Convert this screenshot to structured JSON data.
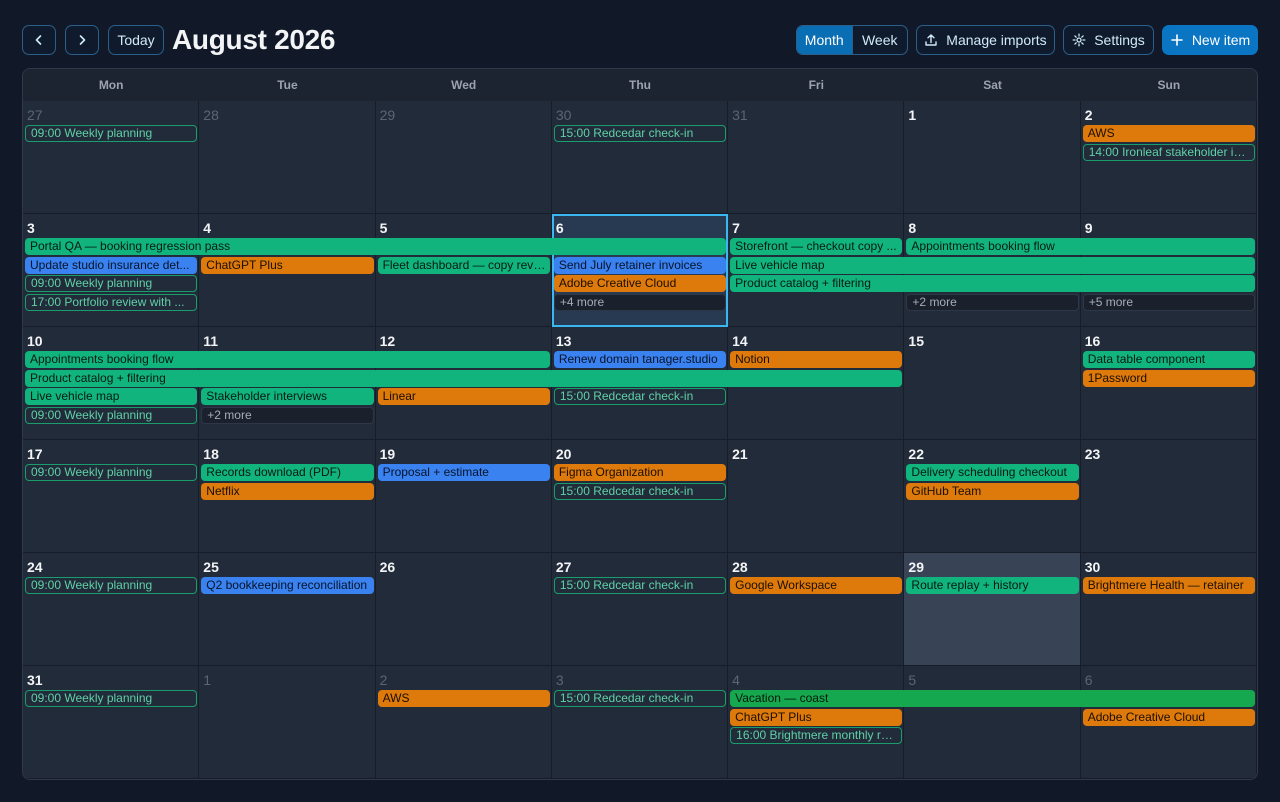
{
  "header": {
    "today_label": "Today",
    "title": "August 2026",
    "view_month": "Month",
    "view_week": "Week",
    "manage_imports": "Manage imports",
    "settings": "Settings",
    "new_item": "New item"
  },
  "colors": {
    "accent": "#0a75c2",
    "event_green": "#10b47c",
    "event_orange": "#dd7a0b",
    "event_blue": "#3a82f0",
    "today_border": "#3ab7f0"
  },
  "calendar": {
    "weekdays": [
      "Mon",
      "Tue",
      "Wed",
      "Thu",
      "Fri",
      "Sat",
      "Sun"
    ],
    "today": {
      "week": 1,
      "day": 3
    },
    "selected": {
      "week": 4,
      "day": 5
    },
    "weeks": [
      [
        {
          "num": "27",
          "other": true
        },
        {
          "num": "28",
          "other": true
        },
        {
          "num": "29",
          "other": true
        },
        {
          "num": "30",
          "other": true
        },
        {
          "num": "31",
          "other": true
        },
        {
          "num": "1"
        },
        {
          "num": "2"
        }
      ],
      [
        {
          "num": "3"
        },
        {
          "num": "4"
        },
        {
          "num": "5"
        },
        {
          "num": "6"
        },
        {
          "num": "7"
        },
        {
          "num": "8"
        },
        {
          "num": "9"
        }
      ],
      [
        {
          "num": "10"
        },
        {
          "num": "11"
        },
        {
          "num": "12"
        },
        {
          "num": "13"
        },
        {
          "num": "14"
        },
        {
          "num": "15"
        },
        {
          "num": "16"
        }
      ],
      [
        {
          "num": "17"
        },
        {
          "num": "18"
        },
        {
          "num": "19"
        },
        {
          "num": "20"
        },
        {
          "num": "21"
        },
        {
          "num": "22"
        },
        {
          "num": "23"
        }
      ],
      [
        {
          "num": "24"
        },
        {
          "num": "25"
        },
        {
          "num": "26"
        },
        {
          "num": "27"
        },
        {
          "num": "28"
        },
        {
          "num": "29"
        },
        {
          "num": "30"
        }
      ],
      [
        {
          "num": "31"
        },
        {
          "num": "1",
          "other": true
        },
        {
          "num": "2",
          "other": true
        },
        {
          "num": "3",
          "other": true
        },
        {
          "num": "4",
          "other": true
        },
        {
          "num": "5",
          "other": true
        },
        {
          "num": "6",
          "other": true
        }
      ]
    ],
    "events": [
      {
        "week": 0,
        "day": 0,
        "span": 1,
        "lane": 0,
        "style": "outline",
        "text": "09:00 Weekly planning"
      },
      {
        "week": 0,
        "day": 3,
        "span": 1,
        "lane": 0,
        "style": "outline",
        "text": "15:00 Redcedar check-in"
      },
      {
        "week": 0,
        "day": 6,
        "span": 1,
        "lane": 0,
        "style": "orange",
        "text": "AWS"
      },
      {
        "week": 0,
        "day": 6,
        "span": 1,
        "lane": 1,
        "style": "outline",
        "text": "14:00 Ironleaf stakeholder in..."
      },
      {
        "week": 1,
        "day": 0,
        "span": 4,
        "lane": 0,
        "style": "green",
        "text": "Portal QA — booking regression pass"
      },
      {
        "week": 1,
        "day": 4,
        "span": 1,
        "lane": 0,
        "style": "green",
        "text": "Storefront — checkout copy ..."
      },
      {
        "week": 1,
        "day": 5,
        "span": 2,
        "lane": 0,
        "style": "green",
        "text": "Appointments booking flow"
      },
      {
        "week": 1,
        "day": 0,
        "span": 1,
        "lane": 1,
        "style": "blue",
        "text": "Update studio insurance det..."
      },
      {
        "week": 1,
        "day": 1,
        "span": 1,
        "lane": 1,
        "style": "orange",
        "text": "ChatGPT Plus"
      },
      {
        "week": 1,
        "day": 2,
        "span": 1,
        "lane": 1,
        "style": "green",
        "text": "Fleet dashboard — copy revi..."
      },
      {
        "week": 1,
        "day": 3,
        "span": 1,
        "lane": 1,
        "style": "blue",
        "text": "Send July retainer invoices"
      },
      {
        "week": 1,
        "day": 4,
        "span": 3,
        "lane": 1,
        "style": "green",
        "text": "Live vehicle map"
      },
      {
        "week": 1,
        "day": 0,
        "span": 1,
        "lane": 2,
        "style": "outline",
        "text": "09:00 Weekly planning"
      },
      {
        "week": 1,
        "day": 3,
        "span": 1,
        "lane": 2,
        "style": "orange",
        "text": "Adobe Creative Cloud"
      },
      {
        "week": 1,
        "day": 4,
        "span": 3,
        "lane": 2,
        "style": "green",
        "text": "Product catalog + filtering"
      },
      {
        "week": 1,
        "day": 0,
        "span": 1,
        "lane": 3,
        "style": "outline",
        "text": "17:00 Portfolio review with ..."
      },
      {
        "week": 1,
        "day": 3,
        "span": 1,
        "lane": 3,
        "style": "more",
        "text": "+4 more"
      },
      {
        "week": 1,
        "day": 5,
        "span": 1,
        "lane": 3,
        "style": "more",
        "text": "+2 more"
      },
      {
        "week": 1,
        "day": 6,
        "span": 1,
        "lane": 3,
        "style": "more",
        "text": "+5 more"
      },
      {
        "week": 2,
        "day": 0,
        "span": 3,
        "lane": 0,
        "style": "green",
        "text": "Appointments booking flow"
      },
      {
        "week": 2,
        "day": 3,
        "span": 1,
        "lane": 0,
        "style": "blue",
        "text": "Renew domain tanager.studio"
      },
      {
        "week": 2,
        "day": 4,
        "span": 1,
        "lane": 0,
        "style": "orange",
        "text": "Notion"
      },
      {
        "week": 2,
        "day": 6,
        "span": 1,
        "lane": 0,
        "style": "green",
        "text": "Data table component"
      },
      {
        "week": 2,
        "day": 0,
        "span": 5,
        "lane": 1,
        "style": "green",
        "text": "Product catalog + filtering"
      },
      {
        "week": 2,
        "day": 6,
        "span": 1,
        "lane": 1,
        "style": "orange",
        "text": "1Password"
      },
      {
        "week": 2,
        "day": 0,
        "span": 1,
        "lane": 2,
        "style": "green",
        "text": "Live vehicle map"
      },
      {
        "week": 2,
        "day": 1,
        "span": 1,
        "lane": 2,
        "style": "green",
        "text": "Stakeholder interviews"
      },
      {
        "week": 2,
        "day": 2,
        "span": 1,
        "lane": 2,
        "style": "orange",
        "text": "Linear"
      },
      {
        "week": 2,
        "day": 3,
        "span": 1,
        "lane": 2,
        "style": "outline",
        "text": "15:00 Redcedar check-in"
      },
      {
        "week": 2,
        "day": 0,
        "span": 1,
        "lane": 3,
        "style": "outline",
        "text": "09:00 Weekly planning"
      },
      {
        "week": 2,
        "day": 1,
        "span": 1,
        "lane": 3,
        "style": "more",
        "text": "+2 more"
      },
      {
        "week": 3,
        "day": 0,
        "span": 1,
        "lane": 0,
        "style": "outline",
        "text": "09:00 Weekly planning"
      },
      {
        "week": 3,
        "day": 1,
        "span": 1,
        "lane": 0,
        "style": "green",
        "text": "Records download (PDF)"
      },
      {
        "week": 3,
        "day": 2,
        "span": 1,
        "lane": 0,
        "style": "blue",
        "text": "Proposal + estimate"
      },
      {
        "week": 3,
        "day": 3,
        "span": 1,
        "lane": 0,
        "style": "orange",
        "text": "Figma Organization"
      },
      {
        "week": 3,
        "day": 5,
        "span": 1,
        "lane": 0,
        "style": "green",
        "text": "Delivery scheduling checkout"
      },
      {
        "week": 3,
        "day": 1,
        "span": 1,
        "lane": 1,
        "style": "orange",
        "text": "Netflix"
      },
      {
        "week": 3,
        "day": 3,
        "span": 1,
        "lane": 1,
        "style": "outline",
        "text": "15:00 Redcedar check-in"
      },
      {
        "week": 3,
        "day": 5,
        "span": 1,
        "lane": 1,
        "style": "orange",
        "text": "GitHub Team"
      },
      {
        "week": 4,
        "day": 0,
        "span": 1,
        "lane": 0,
        "style": "outline",
        "text": "09:00 Weekly planning"
      },
      {
        "week": 4,
        "day": 1,
        "span": 1,
        "lane": 0,
        "style": "blue",
        "text": "Q2 bookkeeping reconciliation"
      },
      {
        "week": 4,
        "day": 3,
        "span": 1,
        "lane": 0,
        "style": "outline",
        "text": "15:00 Redcedar check-in"
      },
      {
        "week": 4,
        "day": 4,
        "span": 1,
        "lane": 0,
        "style": "orange",
        "text": "Google Workspace"
      },
      {
        "week": 4,
        "day": 5,
        "span": 1,
        "lane": 0,
        "style": "green",
        "text": "Route replay + history"
      },
      {
        "week": 4,
        "day": 6,
        "span": 1,
        "lane": 0,
        "style": "orange",
        "text": "Brightmere Health — retainer"
      },
      {
        "week": 5,
        "day": 0,
        "span": 1,
        "lane": 0,
        "style": "outline",
        "text": "09:00 Weekly planning"
      },
      {
        "week": 5,
        "day": 2,
        "span": 1,
        "lane": 0,
        "style": "orange",
        "text": "AWS"
      },
      {
        "week": 5,
        "day": 3,
        "span": 1,
        "lane": 0,
        "style": "outline",
        "text": "15:00 Redcedar check-in"
      },
      {
        "week": 5,
        "day": 4,
        "span": 3,
        "lane": 0,
        "style": "vgreen",
        "text": "Vacation — coast"
      },
      {
        "week": 5,
        "day": 4,
        "span": 1,
        "lane": 1,
        "style": "orange",
        "text": "ChatGPT Plus"
      },
      {
        "week": 5,
        "day": 6,
        "span": 1,
        "lane": 1,
        "style": "orange",
        "text": "Adobe Creative Cloud"
      },
      {
        "week": 5,
        "day": 4,
        "span": 1,
        "lane": 2,
        "style": "outline",
        "text": "16:00 Brightmere monthly re..."
      }
    ]
  }
}
